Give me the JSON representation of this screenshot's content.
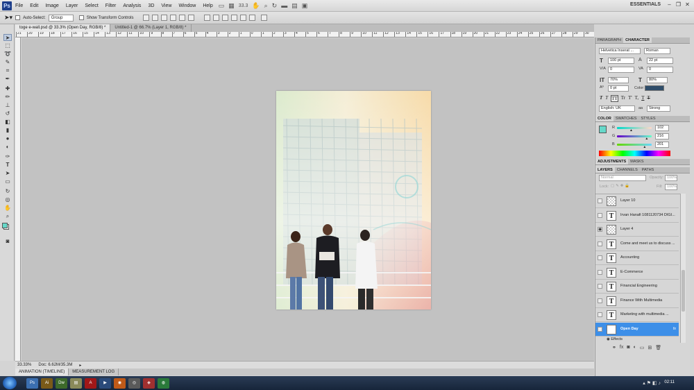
{
  "menubar": {
    "logo": "Ps",
    "items": [
      "File",
      "Edit",
      "Image",
      "Layer",
      "Select",
      "Filter",
      "Analysis",
      "3D",
      "View",
      "Window",
      "Help"
    ],
    "zoom": "33.3",
    "workspace": "ESSENTIALS"
  },
  "options": {
    "auto_select_label": "Auto-Select:",
    "auto_select_value": "Group",
    "show_transform_label": "Show Transform Controls"
  },
  "tabs": [
    {
      "label": "toge e-wall.psd @ 33.3% (Open Day, RGB/8) *"
    },
    {
      "label": "Untitled-1 @ 66.7% (Layer 1, RGB/8) *"
    }
  ],
  "ruler_ticks": [
    "21",
    "20",
    "19",
    "18",
    "17",
    "16",
    "15",
    "14",
    "13",
    "12",
    "11",
    "10",
    "9",
    "8",
    "7",
    "6",
    "5",
    "4",
    "3",
    "2",
    "1",
    "0",
    "1",
    "2",
    "3",
    "4",
    "5",
    "6",
    "7",
    "8",
    "9",
    "10",
    "11",
    "12",
    "13",
    "14",
    "15",
    "16",
    "17",
    "18",
    "19",
    "20",
    "21",
    "22",
    "23",
    "24",
    "25",
    "26",
    "27",
    "28",
    "29",
    "30"
  ],
  "status": {
    "zoom": "33.33%",
    "doc": "Doc: 6.62M/35.3M"
  },
  "bottom_tabs": [
    "ANIMATION (TIMELINE)",
    "MEASUREMENT LOG"
  ],
  "character_panel": {
    "tabs": [
      "PARAGRAPH",
      "CHARACTER"
    ],
    "font_family": "Helvetica Inserat ...",
    "font_style": "Roman",
    "size": "100 pt",
    "leading": "22 pt",
    "kerning": "0",
    "tracking": "0",
    "vscale": "70%",
    "hscale": "80%",
    "baseline": "0 pt",
    "color_label": "Color:",
    "color_value": "#2f4d6a",
    "style_buttons": [
      "T",
      "T",
      "TT",
      "Tr",
      "T'",
      "T,",
      "T",
      "T"
    ],
    "language": "English: UK",
    "aa_label": "aa",
    "antialias": "Strong"
  },
  "color_panel": {
    "tabs": [
      "COLOR",
      "SWATCHES",
      "STYLES"
    ],
    "r_label": "R",
    "r": "102",
    "g_label": "G",
    "g": "216",
    "b_label": "B",
    "b": "201",
    "fg": "#66d8c9",
    "r_frac": 0.4,
    "g_frac": 0.847,
    "b_frac": 0.788
  },
  "adjust_tabs": [
    "ADJUSTMENTS",
    "MASKS"
  ],
  "layers_panel": {
    "tabs": [
      "LAYERS",
      "CHANNELS",
      "PATHS"
    ],
    "blend": "Normal",
    "opacity_label": "Opacity:",
    "opacity": "100%",
    "lock_label": "Lock:",
    "fill_label": "Fill:",
    "fill": "100%",
    "layers": [
      {
        "name": "Layer 10",
        "kind": "pixel",
        "visible": false,
        "selected": false,
        "fx": ""
      },
      {
        "name": "Irvan Hanafi 1081120734  DIGI...",
        "kind": "text",
        "visible": false,
        "selected": false,
        "fx": ""
      },
      {
        "name": "Layer 4",
        "kind": "pixel",
        "visible": true,
        "selected": false,
        "fx": ""
      },
      {
        "name": "Come and meet us to discuss ...",
        "kind": "text",
        "visible": false,
        "selected": false,
        "fx": ""
      },
      {
        "name": "Accounting",
        "kind": "text",
        "visible": false,
        "selected": false,
        "fx": ""
      },
      {
        "name": "E-Commerce",
        "kind": "text",
        "visible": false,
        "selected": false,
        "fx": ""
      },
      {
        "name": "Financial Engineering",
        "kind": "text",
        "visible": false,
        "selected": false,
        "fx": ""
      },
      {
        "name": "Finance With Multimedia",
        "kind": "text",
        "visible": false,
        "selected": false,
        "fx": ""
      },
      {
        "name": "Marketing with multimedia ...",
        "kind": "text",
        "visible": false,
        "selected": false,
        "fx": ""
      },
      {
        "name": "Open Day",
        "kind": "text",
        "visible": false,
        "selected": true,
        "fx": "fx"
      }
    ],
    "effects_label": "Effects"
  },
  "taskbar": {
    "time": "02:11"
  }
}
